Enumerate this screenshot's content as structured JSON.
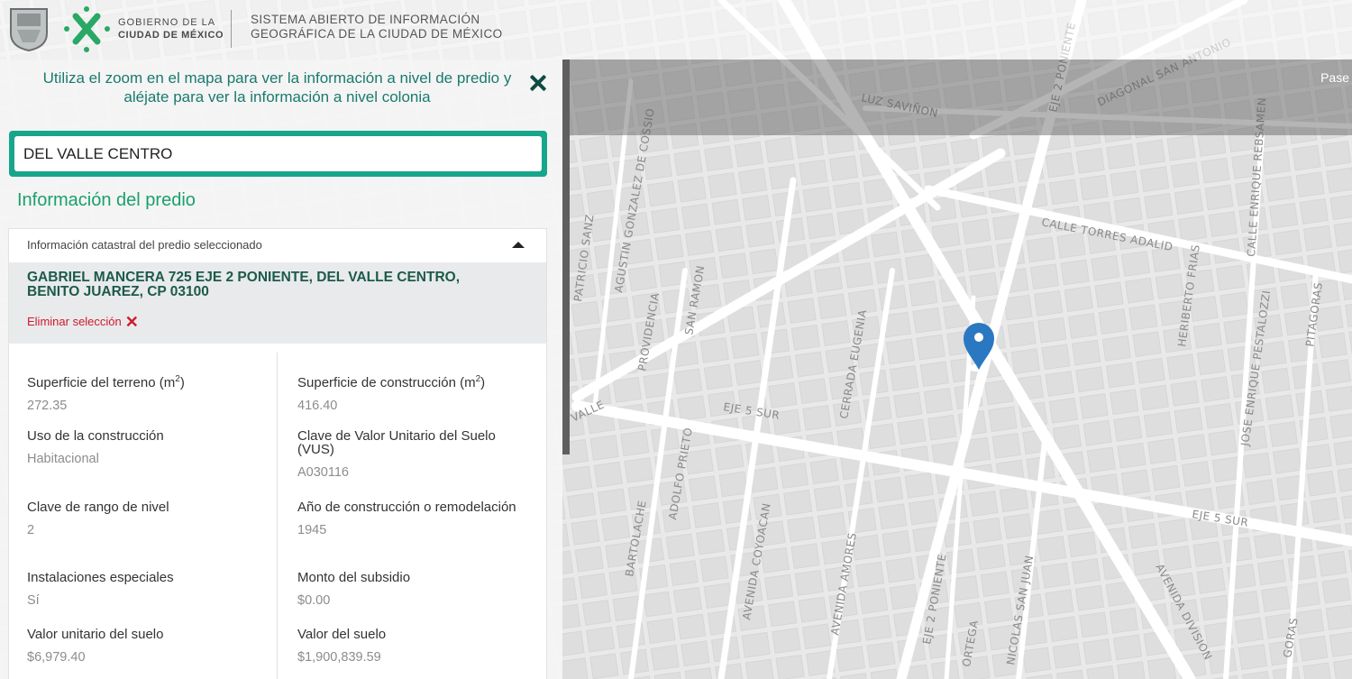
{
  "header": {
    "gov_line1": "GOBIERNO DE LA",
    "gov_line2": "CIUDAD DE MÉXICO",
    "system_line1": "SISTEMA ABIERTO DE INFORMACIÓN",
    "system_line2": "GEOGRÁFICA DE LA CIUDAD DE MÉXICO"
  },
  "panel": {
    "hint": "Utiliza el zoom en el mapa para ver la información a nivel de predio y aléjate para ver la información a nivel colonia",
    "search_value": "DEL VALLE CENTRO",
    "section_title": "Información del predio",
    "card_title": "Información catastral del predio seleccionado",
    "address": "GABRIEL MANCERA 725 EJE 2 PONIENTE, DEL VALLE CENTRO, BENITO JUAREZ, CP 03100",
    "remove_label": "Eliminar selección",
    "fields": {
      "superficie_terreno": {
        "label": "Superficie del terreno (m",
        "sup": "2",
        "label_end": ")",
        "value": "272.35"
      },
      "superficie_construccion": {
        "label": "Superficie de construcción (m",
        "sup": "2",
        "label_end": ")",
        "value": "416.40"
      },
      "uso": {
        "label": "Uso de la construcción",
        "value": "Habitacional"
      },
      "vus": {
        "label": "Clave de Valor Unitario del Suelo (VUS)",
        "value": "A030116"
      },
      "rango_nivel": {
        "label": "Clave de rango de nivel",
        "value": "2"
      },
      "anio": {
        "label": "Año de construcción o remodelación",
        "value": "1945"
      },
      "instalaciones": {
        "label": "Instalaciones especiales",
        "value": "Sí"
      },
      "subsidio": {
        "label": "Monto del subsidio",
        "value": "$0.00"
      },
      "valor_unitario": {
        "label": "Valor unitario del suelo",
        "value": "$6,979.40"
      },
      "valor_suelo": {
        "label": "Valor del suelo",
        "value": "$1,900,839.59"
      }
    }
  },
  "map": {
    "overlay_text": "Pase",
    "streets": [
      "LUZ SAVIÑON",
      "EJE 2 PONIENTE",
      "DIAGONAL SAN ANTONIO",
      "CALLE TORRES ADALID",
      "CALLE ENRIQUE REBSAMEN",
      "PATRICIO SANZ",
      "AGUSTIN GONZALEZ DE COSSIO",
      "PROVIDENCIA",
      "SAN RAMON",
      "CERRADA EUGENIA",
      "HERIBERTO FRIAS",
      "JOSE ENRIQUE PESTALOZZI",
      "PITAGORAS",
      "VALLE",
      "EJE 5 SUR",
      "ADOLFO PRIETO",
      "BARTOLACHE",
      "AVENIDA COYOACAN",
      "AVENIDA AMORES",
      "EJE 2 PONIENTE",
      "ORTEGA",
      "NICOLAS SAN JUAN",
      "AVENIDA DIVISION",
      "EJE 5 SUR",
      "GORAS"
    ],
    "marker_color": "#2b78c2"
  }
}
